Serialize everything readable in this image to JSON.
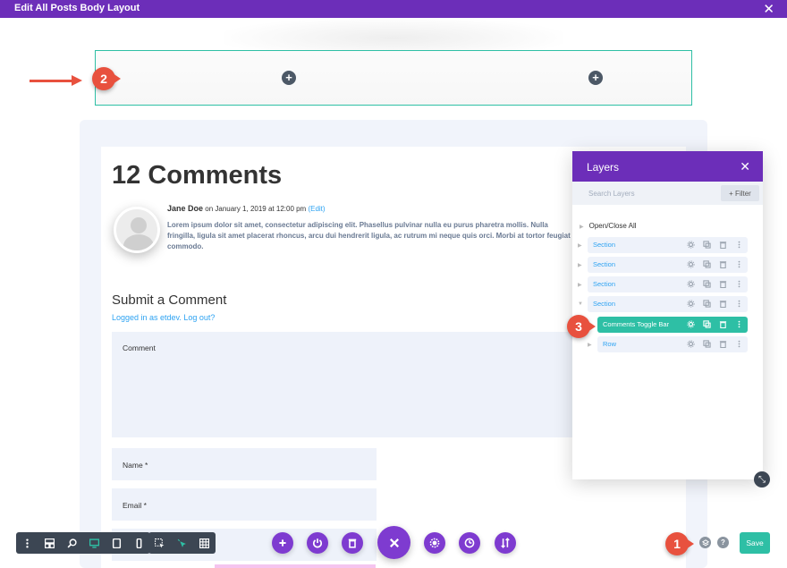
{
  "window": {
    "title": "Edit All Posts Body Layout",
    "close_icon": "close-icon"
  },
  "annotations": {
    "marker_1": "1",
    "marker_2": "2",
    "marker_3": "3",
    "color": "#e8513e"
  },
  "post": {
    "comments_title": "12 Comments",
    "author": "Jane Doe",
    "meta": " on January 1, 2019 at 12:00 pm ",
    "edit_link": "(Edit)",
    "comment_text": "Lorem ipsum dolor sit amet, consectetur adipiscing elit. Phasellus pulvinar nulla eu purus pharetra mollis. Nulla fringilla, ligula sit amet placerat rhoncus, arcu dui hendrerit ligula, ac rutrum mi neque quis orci. Morbi at tortor feugiat commodo."
  },
  "comment_form": {
    "title": "Submit a Comment",
    "logged_in": "Logged in as etdev. Log out?",
    "comment_placeholder": "Comment",
    "name_placeholder": "Name *",
    "email_placeholder": "Email *"
  },
  "layers_panel": {
    "title": "Layers",
    "search_placeholder": "Search Layers",
    "filter_label": "+ Filter",
    "open_close_all": "Open/Close All",
    "items": [
      {
        "label": "Section",
        "active": false
      },
      {
        "label": "Section",
        "active": false
      },
      {
        "label": "Section",
        "active": false
      },
      {
        "label": "Section",
        "active": false
      },
      {
        "label": "Comments Toggle Bar",
        "active": true
      },
      {
        "label": "Row",
        "active": false
      }
    ]
  },
  "bottom_toolbar": {
    "help_label": "?",
    "save_label": "Save"
  },
  "colors": {
    "purple": "#6c2eb9",
    "button_purple": "#7e3bd0",
    "teal": "#2ebfa5",
    "link_blue": "#2ea3f2",
    "dark": "#3c4653"
  }
}
